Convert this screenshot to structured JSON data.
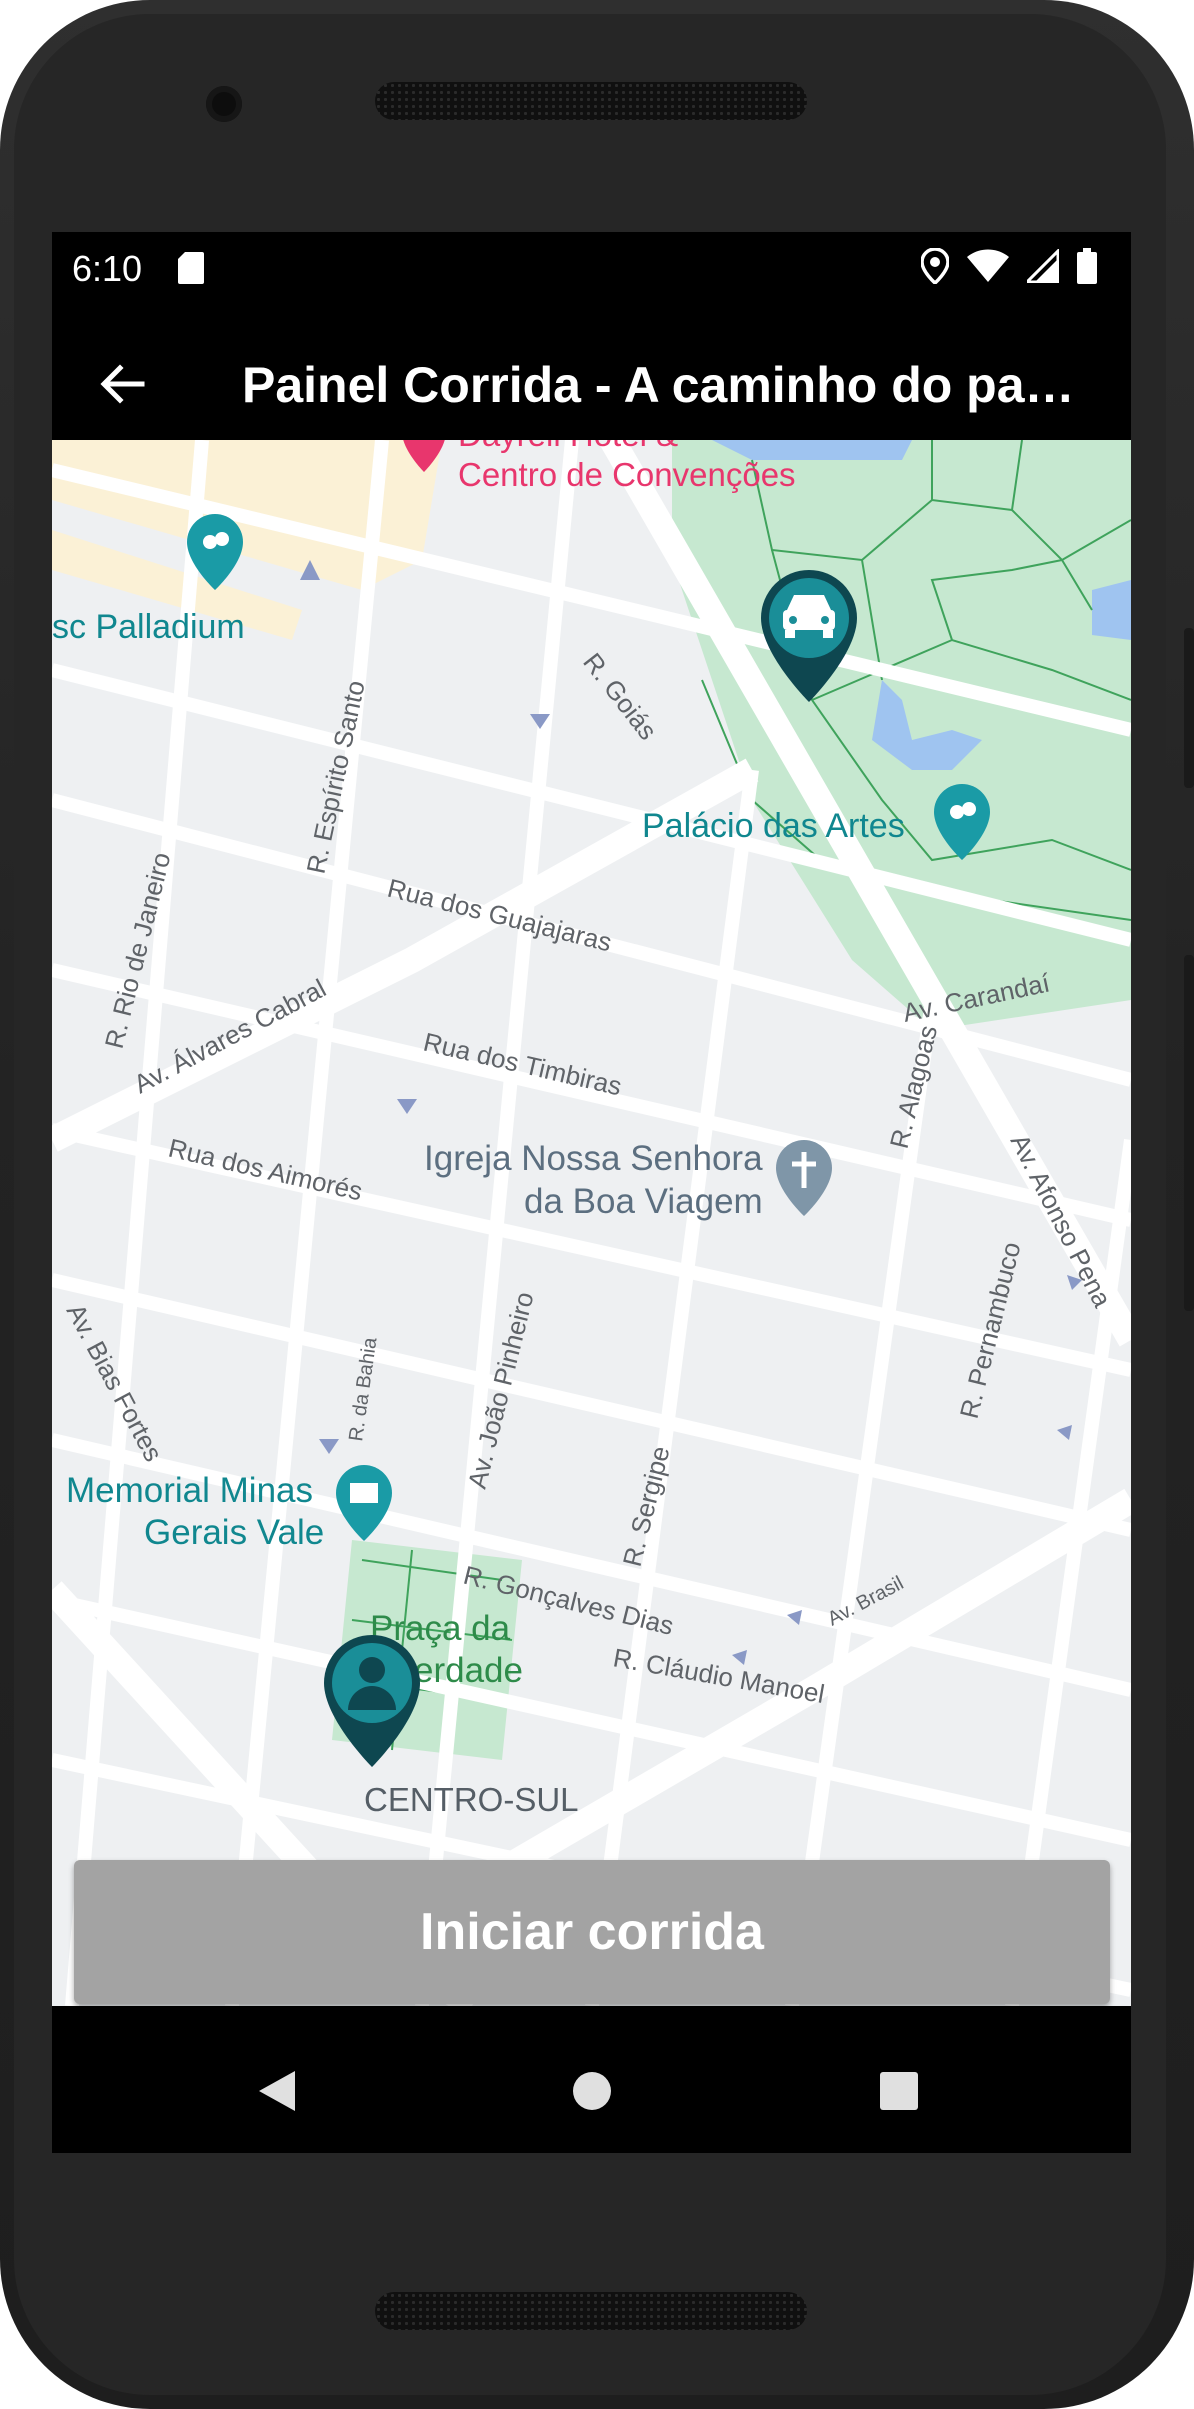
{
  "status_bar": {
    "time": "6:10",
    "icons": [
      "sd-card-icon",
      "location-icon",
      "wifi-icon",
      "signal-icon",
      "battery-icon"
    ]
  },
  "app_bar": {
    "back_icon": "arrow-back-icon",
    "title": "Painel Corrida - A caminho do passageiro"
  },
  "map": {
    "labels": {
      "hotel": "Dayrell Hotel &",
      "hotel_2": "Centro de Convenções",
      "palladium": "sc Palladium",
      "palacio": "Palácio das Artes",
      "igreja_1": "Igreja Nossa Senhora",
      "igreja_2": "da Boa Viagem",
      "memorial_1": "Memorial Minas",
      "memorial_2": "Gerais Vale",
      "praca_1": "Praça da",
      "praca_2": "erdade",
      "centro_sul": "CENTRO-SUL"
    },
    "streets": {
      "goias": "R. Goiás",
      "espirito_santo": "R. Espírito Santo",
      "guajajaras": "Rua dos Guajajaras",
      "rio_janeiro": "R. Rio de Janeiro",
      "alvares_cabral": "Av. Álvares Cabral",
      "timbiras": "Rua dos Timbiras",
      "aimores": "Rua dos Aimorés",
      "carandai": "Av. Carandaí",
      "alagoas": "R. Alagoas",
      "afonso_pena": "Av. Afonso Pena",
      "bahia": "R. da Bahia",
      "joao_pinheiro": "Av. João Pinheiro",
      "pernambuco": "R. Pernambuco",
      "bias_fortes": "Av. Bias Fortes",
      "sergipe": "R. Sergipe",
      "goncalves_dias": "R. Gonçalves Dias",
      "brasil": "Av. Brasil",
      "claudio_manoel": "R. Cláudio Manoel"
    },
    "markers": {
      "driver": "car-marker-icon",
      "passenger": "person-marker-icon"
    },
    "colors": {
      "poi_teal": "#10878f",
      "marker_teal": "#1a8e98",
      "marker_dark": "#0e4750",
      "park": "#c6e8d0",
      "hotel_pink": "#e8366d"
    }
  },
  "action": {
    "start_ride_label": "Iniciar corrida"
  },
  "nav_bar": {
    "icons": [
      "back-triangle-icon",
      "home-circle-icon",
      "recents-square-icon"
    ]
  }
}
